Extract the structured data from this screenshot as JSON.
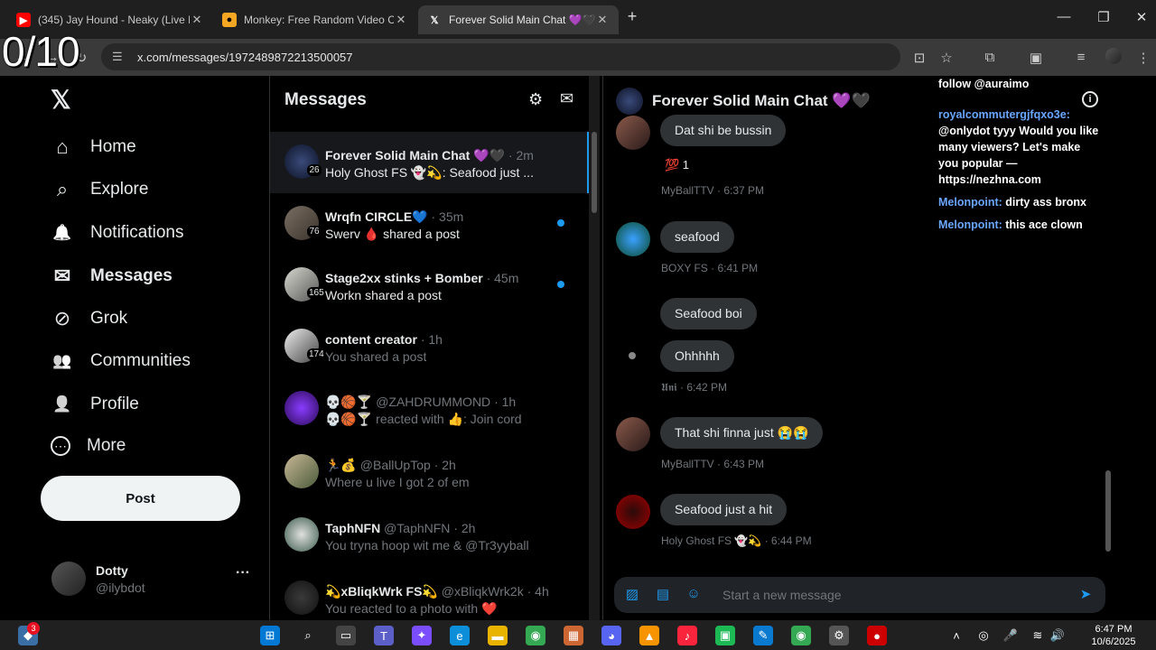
{
  "overlay_counter": "0/10",
  "browser": {
    "tabs": [
      {
        "title": "(345) Jay Hound - Neaky (Live P",
        "favicon": "youtube-icon",
        "color": "#ff0000"
      },
      {
        "title": "Monkey: Free Random Video Ch",
        "favicon": "monkey-icon",
        "color": "#f5a623"
      },
      {
        "title": "Forever Solid Main Chat 💜🖤 ·",
        "favicon": "x-icon",
        "color": "#000000"
      }
    ],
    "new_tab": "+",
    "url": "x.com/messages/1972489872213500057",
    "window": {
      "minimize": "—",
      "maximize": "❐",
      "close": "✕"
    }
  },
  "nav": {
    "logo": "𝕏",
    "items": [
      {
        "label": "Home",
        "icon": "home-icon",
        "glyph": "⌂"
      },
      {
        "label": "Explore",
        "icon": "search-icon",
        "glyph": "⌕"
      },
      {
        "label": "Notifications",
        "icon": "bell-icon",
        "glyph": "🔔"
      },
      {
        "label": "Messages",
        "icon": "envelope-icon",
        "glyph": "✉"
      },
      {
        "label": "Grok",
        "icon": "grok-icon",
        "glyph": "⊘"
      },
      {
        "label": "Communities",
        "icon": "communities-icon",
        "glyph": "👥"
      },
      {
        "label": "Profile",
        "icon": "person-icon",
        "glyph": "👤"
      },
      {
        "label": "More",
        "icon": "more-circle-icon",
        "glyph": "⋯"
      }
    ],
    "post_label": "Post",
    "user": {
      "name": "Dotty",
      "handle": "@ilybdot",
      "more": "···"
    }
  },
  "messages": {
    "title": "Messages",
    "conversations": [
      {
        "name": "Forever Solid Main Chat 💜🖤",
        "time": "· 2m",
        "preview": "Holy Ghost FS 👻💫: Seafood just ...",
        "badge": "26",
        "unread": true,
        "selected": true,
        "dot": false
      },
      {
        "name": "Wrqfn CIRCLE💙",
        "time": "· 35m",
        "preview": "Swerv 🩸 shared a post",
        "badge": "76",
        "unread": true,
        "selected": false,
        "dot": true
      },
      {
        "name": "Stage2xx stinks + Bomber",
        "time": "· 45m",
        "preview": "Workn shared a post",
        "badge": "165",
        "unread": true,
        "selected": false,
        "dot": true
      },
      {
        "name": "content creator",
        "time": "· 1h",
        "preview": "You shared a post",
        "badge": "174",
        "unread": false,
        "selected": false,
        "dot": false
      },
      {
        "name": "💀🏀🍸",
        "handle": "@ZAHDRUMMOND",
        "time": "· 1h",
        "preview": "💀🏀🍸 reacted with 👍: Join cord",
        "badge": "",
        "unread": false,
        "selected": false,
        "dot": false
      },
      {
        "name": "🏃💰",
        "handle": "@BallUpTop",
        "time": "· 2h",
        "preview": "Where u live I got 2 of em",
        "badge": "",
        "unread": false,
        "selected": false,
        "dot": false
      },
      {
        "name": "TaphNFN",
        "handle": "@TaphNFN",
        "time": "· 2h",
        "preview": "You tryna hoop wit me & @Tr3yyball",
        "badge": "",
        "unread": false,
        "selected": false,
        "dot": false
      },
      {
        "name": "💫xBliqkWrk FS💫",
        "handle": "@xBliqkWrk2k",
        "time": "· 4h",
        "preview": "You reacted to a photo with ❤️",
        "badge": "",
        "unread": false,
        "selected": false,
        "dot": false
      }
    ]
  },
  "chat": {
    "title": "Forever Solid Main Chat 💜🖤",
    "messages": [
      {
        "text": "Dat shi be bussin"
      },
      {
        "reaction": "💯 1"
      },
      {
        "meta": "MyBallTTV · 6:37 PM"
      },
      {
        "text": "seafood"
      },
      {
        "meta": "BOXY FS · 6:41 PM"
      },
      {
        "text": "Seafood boi"
      },
      {
        "text": "Ohhhhh"
      },
      {
        "meta": "𝖀𝖓𝖎 · 6:42 PM"
      },
      {
        "text": "That shi finna just 😭😭"
      },
      {
        "meta": "MyBallTTV · 6:43 PM"
      },
      {
        "text": "Seafood just a hit"
      },
      {
        "meta": "Holy Ghost FS 👻💫 · 6:44 PM"
      }
    ],
    "composer_placeholder": "Start a new message"
  },
  "stream_chat": {
    "top_line": "follow @auraimo",
    "lines": [
      {
        "user": "royalcommutergjfqxo3e:",
        "text": " @onlydot tyyy Would you like many viewers? Let's make you popular — https://nezhna.com"
      },
      {
        "user": "Melonpoint:",
        "text": " dirty ass bronx"
      },
      {
        "user": "Melonpoint:",
        "text": " this ace clown"
      }
    ]
  },
  "taskbar": {
    "notification_badge": "3",
    "time": "6:47 PM",
    "date": "10/6/2025"
  }
}
